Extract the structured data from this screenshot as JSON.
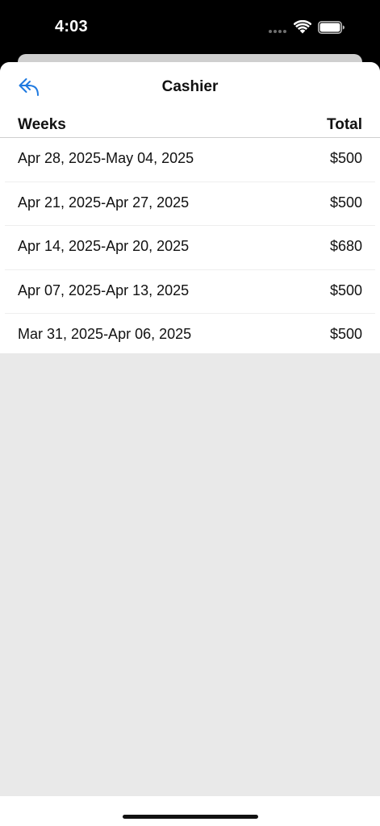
{
  "status_bar": {
    "time": "4:03"
  },
  "nav": {
    "title": "Cashier",
    "back_icon": "reply-back-arrow-icon",
    "accent_color": "#1f7ae0"
  },
  "table": {
    "headers": {
      "weeks": "Weeks",
      "total": "Total"
    },
    "rows": [
      {
        "week": "Apr 28, 2025-May 04, 2025",
        "total": "$500"
      },
      {
        "week": "Apr 21, 2025-Apr 27, 2025",
        "total": "$500"
      },
      {
        "week": "Apr 14, 2025-Apr 20, 2025",
        "total": "$680"
      },
      {
        "week": "Apr 07, 2025-Apr 13, 2025",
        "total": "$500"
      },
      {
        "week": "Mar 31, 2025-Apr 06, 2025",
        "total": "$500"
      }
    ]
  }
}
